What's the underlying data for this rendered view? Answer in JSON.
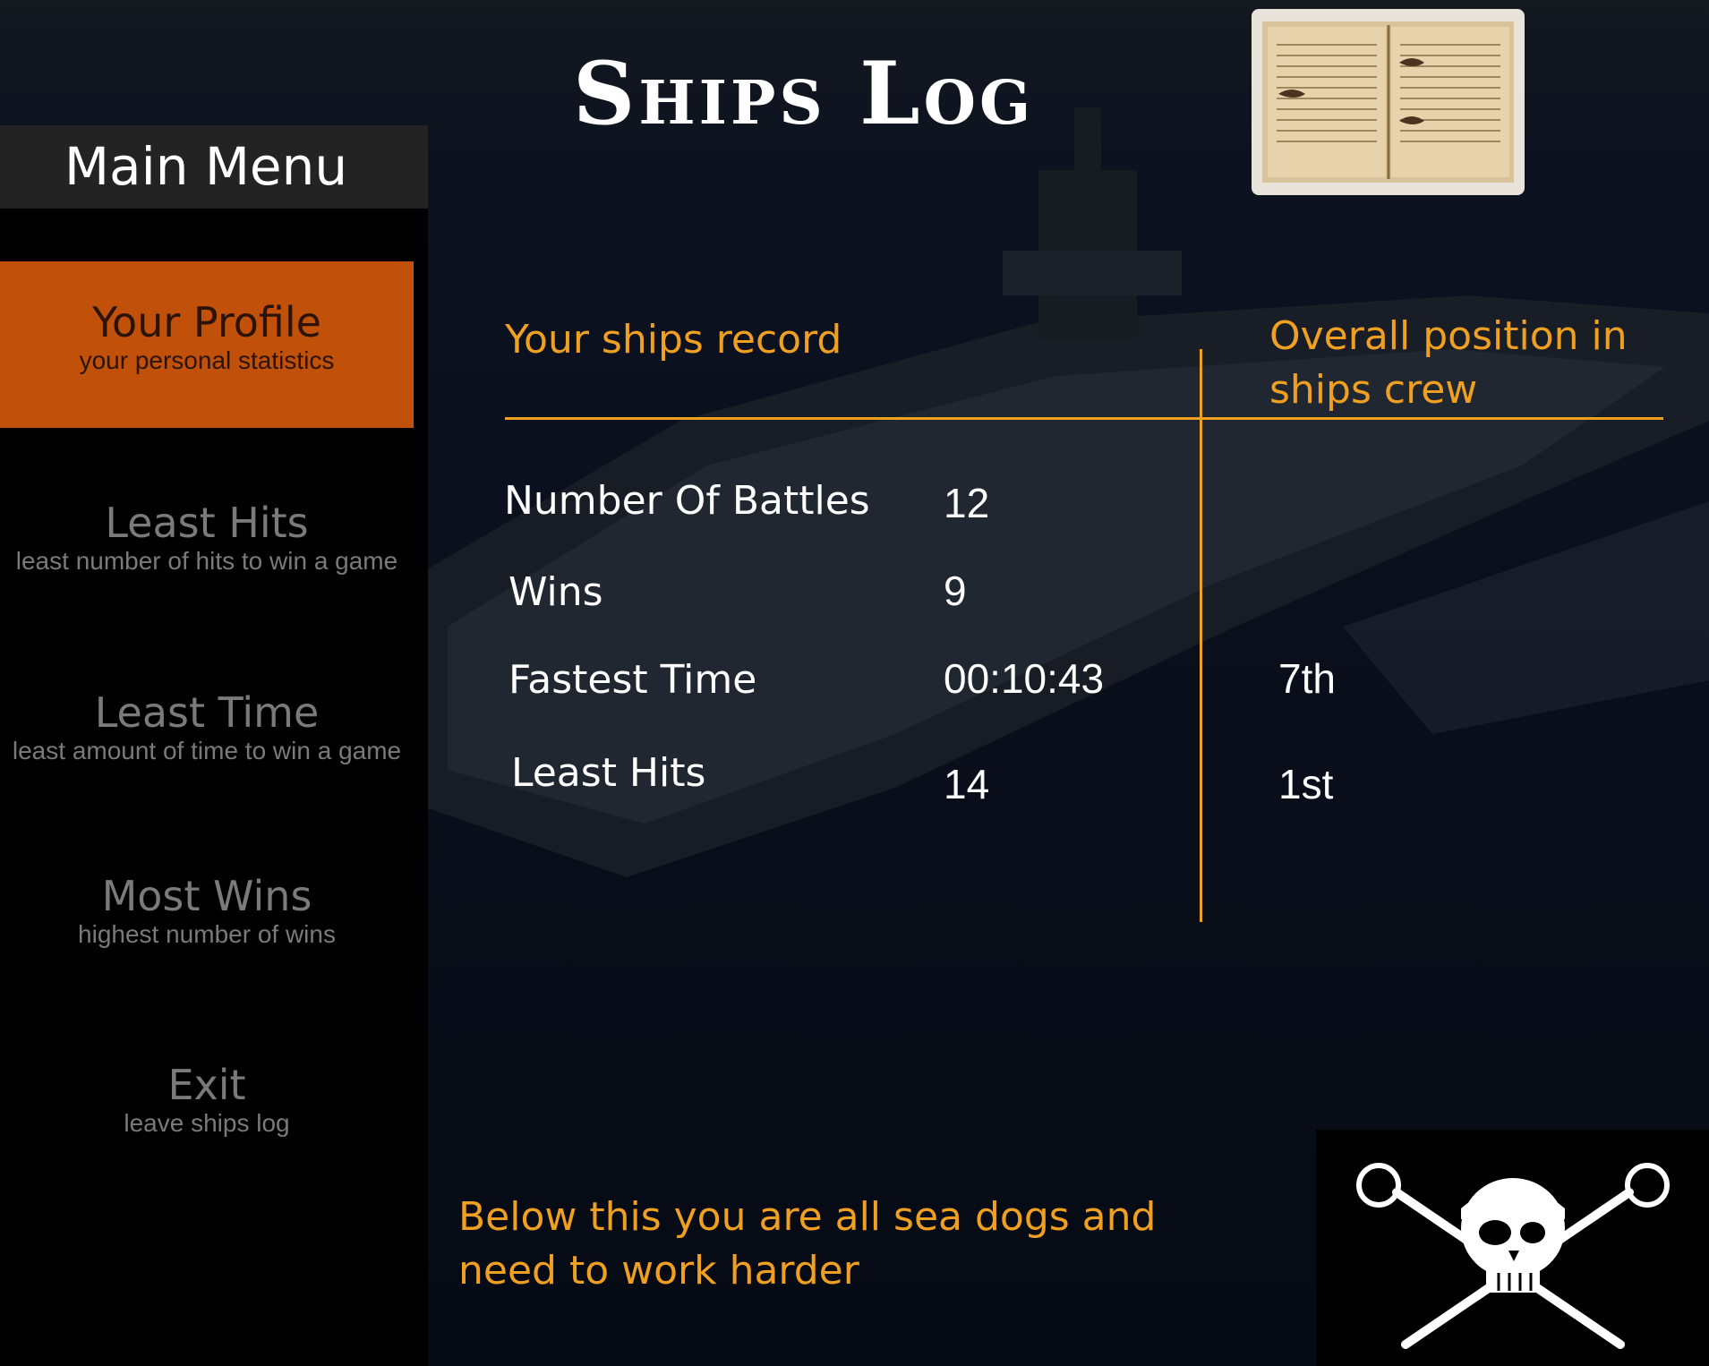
{
  "title": "Ships Log",
  "sidebar": {
    "header": "Main Menu",
    "items": [
      {
        "label": "Your Profile",
        "sub": "your personal statistics",
        "active": true
      },
      {
        "label": "Least Hits",
        "sub": "least number of hits to win a game"
      },
      {
        "label": "Least Time",
        "sub": "least amount of time to win a game"
      },
      {
        "label": "Most Wins",
        "sub": "highest number of wins"
      },
      {
        "label": "Exit",
        "sub": "leave ships log"
      }
    ]
  },
  "record": {
    "heading_left": "Your ships record",
    "heading_right": "Overall position in ships crew",
    "rows": [
      {
        "label": "Number Of Battles",
        "value": "12",
        "position": ""
      },
      {
        "label": "Wins",
        "value": "9",
        "position": ""
      },
      {
        "label": "Fastest Time",
        "value": "00:10:43",
        "position": "7th"
      },
      {
        "label": "Least Hits",
        "value": "14",
        "position": "1st"
      }
    ]
  },
  "note": "Below this you are all sea dogs and need to work harder",
  "colors": {
    "accent": "#f0a020",
    "active_menu": "#c0500a",
    "sidebar": "#000000",
    "header": "#232323"
  },
  "icons": [
    "logbook-image",
    "jolly-roger-icon"
  ]
}
